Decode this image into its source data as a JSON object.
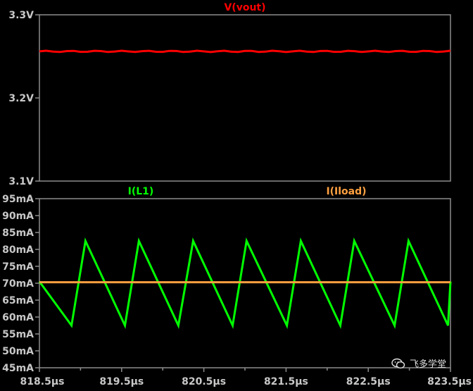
{
  "chart_data": [
    {
      "type": "line",
      "title": "",
      "series": [
        {
          "name": "V(vout)",
          "color": "#ff0000",
          "x": [
            818.5,
            819.0,
            819.5,
            820.0,
            820.5,
            821.0,
            821.5,
            822.0,
            822.5,
            823.0,
            823.5
          ],
          "y": [
            3.256,
            3.256,
            3.256,
            3.256,
            3.256,
            3.256,
            3.256,
            3.256,
            3.256,
            3.256,
            3.256
          ]
        }
      ],
      "xlim": [
        818.5,
        823.5
      ],
      "ylim": [
        3.1,
        3.3
      ],
      "yticks": [
        "3.3V",
        "3.2V",
        "3.1V"
      ],
      "ytick_values": [
        3.3,
        3.2,
        3.1
      ],
      "grid": false
    },
    {
      "type": "line",
      "title": "",
      "series": [
        {
          "name": "I(L1)",
          "color": "#00ff00",
          "x": [
            818.5,
            818.89,
            819.06,
            819.54,
            819.71,
            820.19,
            820.37,
            820.85,
            821.02,
            821.51,
            821.68,
            822.16,
            822.33,
            822.82,
            822.99,
            823.47,
            823.5
          ],
          "y": [
            70.5,
            57.5,
            82.5,
            57.5,
            82.5,
            57.5,
            82.5,
            57.5,
            82.5,
            57.5,
            82.5,
            57.5,
            82.5,
            57.5,
            82.5,
            57.5,
            70.5
          ]
        },
        {
          "name": "I(Iload)",
          "color": "#ffa040",
          "x": [
            818.5,
            823.5
          ],
          "y": [
            70.3,
            70.3
          ]
        }
      ],
      "xlim": [
        818.5,
        823.5
      ],
      "ylim": [
        45,
        95
      ],
      "yticks": [
        "95mA",
        "90mA",
        "85mA",
        "80mA",
        "75mA",
        "70mA",
        "65mA",
        "60mA",
        "55mA",
        "50mA",
        "45mA"
      ],
      "ytick_values": [
        95,
        90,
        85,
        80,
        75,
        70,
        65,
        60,
        55,
        50,
        45
      ],
      "xticks": [
        "818.5µs",
        "819.5µs",
        "820.5µs",
        "821.5µs",
        "822.5µs",
        "823.5µs"
      ],
      "xtick_values": [
        818.5,
        819.5,
        820.5,
        821.5,
        822.5,
        823.5
      ],
      "grid": false
    }
  ],
  "colors": {
    "background": "#000000",
    "frame": "#8c8c8c",
    "tick_text": "#c8c8c8"
  },
  "watermark": {
    "text": "飞多学堂",
    "icon": "wechat-icon"
  }
}
